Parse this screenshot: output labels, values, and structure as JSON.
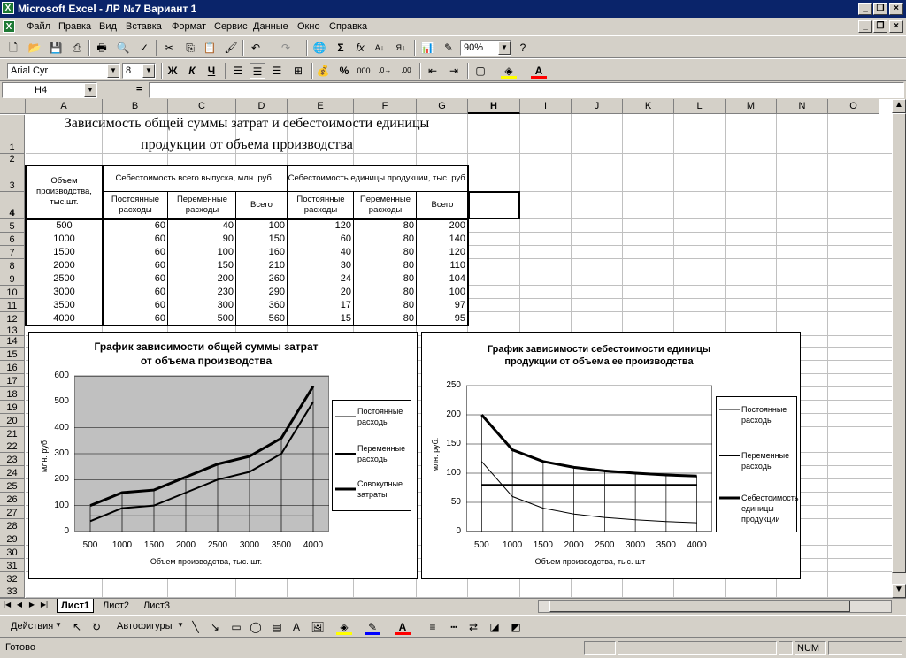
{
  "window": {
    "title": "Microsoft Excel - ЛР №7  Вариант 1"
  },
  "menu": [
    "Файл",
    "Правка",
    "Вид",
    "Вставка",
    "Формат",
    "Сервис",
    "Данные",
    "Окно",
    "Справка"
  ],
  "toolbar": {
    "zoom": "90%",
    "font": "Arial Cyr",
    "size": "8",
    "bold": "Ж",
    "italic": "К",
    "underline": "Ч"
  },
  "formula": {
    "name_box": "H4",
    "eq": "=",
    "value": ""
  },
  "columns": [
    "A",
    "B",
    "C",
    "D",
    "E",
    "F",
    "G",
    "H",
    "I",
    "J",
    "K",
    "L",
    "M",
    "N",
    "O"
  ],
  "rows": [
    "1",
    "2",
    "3",
    "4",
    "5",
    "6",
    "7",
    "8",
    "9",
    "10",
    "11",
    "12",
    "13",
    "14",
    "15",
    "16",
    "17",
    "18",
    "19",
    "20",
    "21",
    "22",
    "23",
    "24",
    "25",
    "26",
    "27",
    "28",
    "29",
    "30",
    "31",
    "32",
    "33"
  ],
  "sheet": {
    "title_line1": "Зависимость общей суммы затрат и себестоимости единицы",
    "title_line2": "продукции от объема производства",
    "h_volume": "Объем производства, тыс.шт.",
    "h_total_cost": "Себестоимость всего выпуска, млн. руб.",
    "h_unit_cost": "Себестоимость единицы продукции, тыс. руб.",
    "h_fixed": "Постоянные расходы",
    "h_variable": "Переменные расходы",
    "h_total": "Всего",
    "h_fixed2": "Постоянные расходы",
    "h_variable2": "Переменные расходы",
    "h_total2": "Всего",
    "data": [
      [
        "500",
        "60",
        "40",
        "100",
        "120",
        "80",
        "200"
      ],
      [
        "1000",
        "60",
        "90",
        "150",
        "60",
        "80",
        "140"
      ],
      [
        "1500",
        "60",
        "100",
        "160",
        "40",
        "80",
        "120"
      ],
      [
        "2000",
        "60",
        "150",
        "210",
        "30",
        "80",
        "110"
      ],
      [
        "2500",
        "60",
        "200",
        "260",
        "24",
        "80",
        "104"
      ],
      [
        "3000",
        "60",
        "230",
        "290",
        "20",
        "80",
        "100"
      ],
      [
        "3500",
        "60",
        "300",
        "360",
        "17",
        "80",
        "97"
      ],
      [
        "4000",
        "60",
        "500",
        "560",
        "15",
        "80",
        "95"
      ]
    ]
  },
  "chart_data": [
    {
      "type": "line",
      "title": "График зависимости общей суммы затрат от объема производства",
      "title_line1": "График зависимости общей суммы затрат",
      "title_line2": "от объема производства",
      "xlabel": "Объем производства, тыс. шт.",
      "ylabel": "млн. руб",
      "ylim": [
        0,
        600
      ],
      "yticks": [
        "0",
        "100",
        "200",
        "300",
        "400",
        "500",
        "600"
      ],
      "categories": [
        "500",
        "1000",
        "1500",
        "2000",
        "2500",
        "3000",
        "3500",
        "4000"
      ],
      "legend_position": "right",
      "series": [
        {
          "name": "Постоянные расходы",
          "values": [
            60,
            60,
            60,
            60,
            60,
            60,
            60,
            60
          ],
          "weight": 1
        },
        {
          "name": "Переменные расходы",
          "values": [
            40,
            90,
            100,
            150,
            200,
            230,
            300,
            500
          ],
          "weight": 2
        },
        {
          "name": "Совокупные затраты",
          "values": [
            100,
            150,
            160,
            210,
            260,
            290,
            360,
            560
          ],
          "weight": 3
        }
      ]
    },
    {
      "type": "line",
      "title": "График зависимости себестоимости единицы продукции от объема ее производства",
      "title_line1": "График зависимости себестоимости единицы",
      "title_line2": "продукции от объема ее производства",
      "xlabel": "Объем производства, тыс. шт",
      "ylabel": "млн. руб.",
      "ylim": [
        0,
        250
      ],
      "yticks": [
        "0",
        "50",
        "100",
        "150",
        "200",
        "250"
      ],
      "categories": [
        "500",
        "1000",
        "1500",
        "2000",
        "2500",
        "3000",
        "3500",
        "4000"
      ],
      "legend_position": "right",
      "series": [
        {
          "name": "Постоянные расходы",
          "values": [
            120,
            60,
            40,
            30,
            24,
            20,
            17,
            15
          ],
          "weight": 1
        },
        {
          "name": "Переменные расходы",
          "values": [
            80,
            80,
            80,
            80,
            80,
            80,
            80,
            80
          ],
          "weight": 2
        },
        {
          "name": "Себестоимость единицы продукции",
          "values": [
            200,
            140,
            120,
            110,
            104,
            100,
            97,
            95
          ],
          "weight": 3
        }
      ]
    }
  ],
  "legend1": [
    "Постоянные расходы",
    "Переменные расходы",
    "Совокупные затраты"
  ],
  "legend2": [
    "Постоянные расходы",
    "Переменные расходы",
    "Себестоимость единицы продукции"
  ],
  "tabs": [
    "Лист1",
    "Лист2",
    "Лист3"
  ],
  "drawbar": {
    "actions": "Действия",
    "autoshapes": "Автофигуры"
  },
  "status": {
    "ready": "Готово",
    "num": "NUM"
  }
}
